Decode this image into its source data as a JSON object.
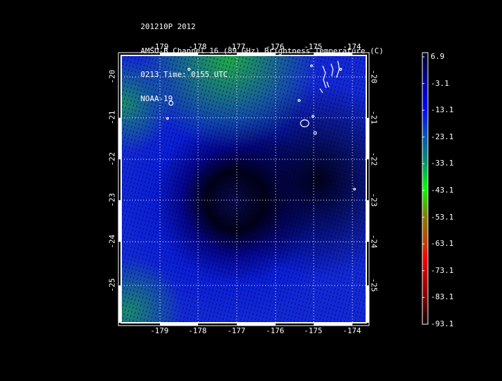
{
  "header": {
    "lines": [
      "201210P 2012",
      "AMSU-B Channel 16 (89 GHz) Brightness Temperature (C)",
      "0213 Time: 0155 UTC",
      "NOAA-19"
    ]
  },
  "map": {
    "lon_labels": [
      "-179",
      "-178",
      "-177",
      "-176",
      "-175",
      "-174"
    ],
    "lat_labels": [
      "-20",
      "-21",
      "-22",
      "-23",
      "-24",
      "-25"
    ],
    "grid": "dotted",
    "coastline_color": "#ffffff"
  },
  "colorbar": {
    "labels": [
      "6.9",
      "-3.1",
      "-13.1",
      "-23.1",
      "-33.1",
      "-43.1",
      "-53.1",
      "-63.1",
      "-73.1",
      "-83.1",
      "-93.1"
    ],
    "colors": [
      "#000033",
      "#000099",
      "#0000ff",
      "#0050c0",
      "#009070",
      "#00ff00",
      "#808000",
      "#c04000",
      "#ff0000",
      "#800000",
      "#200000"
    ]
  }
}
